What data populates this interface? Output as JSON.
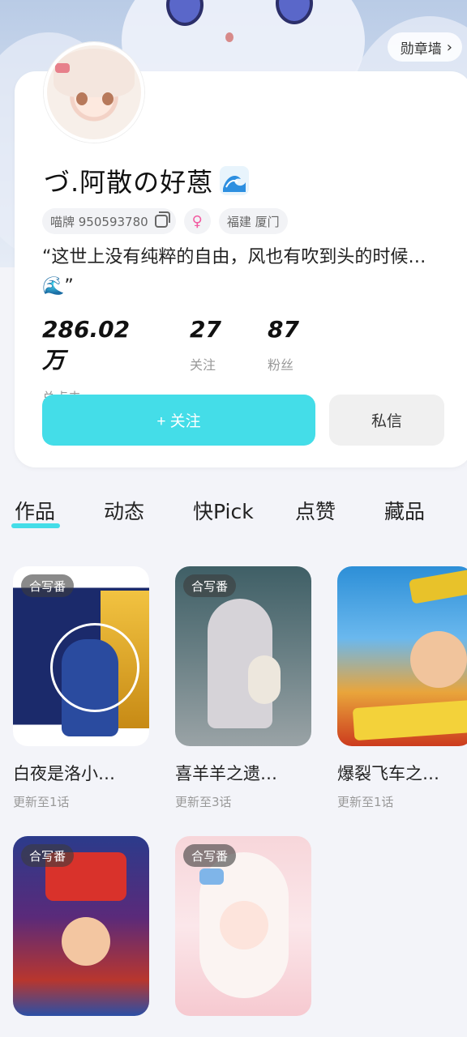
{
  "header": {
    "medal_wall_label": "勋章墙"
  },
  "profile": {
    "nickname": "づ.阿散の好蒽",
    "id_label": "喵牌 950593780",
    "gender_symbol": "♀",
    "location": "福建 厦门",
    "bio": "“这世上没有纯粹的自由，风也有吹到头的时候…🌊”",
    "stats": [
      {
        "value": "286.02万",
        "label": "总点击"
      },
      {
        "value": "27",
        "label": "关注"
      },
      {
        "value": "87",
        "label": "粉丝"
      }
    ],
    "follow_label": "+ 关注",
    "message_label": "私信",
    "accent_color": "#44dde8"
  },
  "tabs": [
    {
      "label": "作品",
      "active": true
    },
    {
      "label": "动态",
      "active": false
    },
    {
      "label": "快Pick",
      "active": false
    },
    {
      "label": "点赞",
      "active": false
    },
    {
      "label": "藏品",
      "active": false
    }
  ],
  "works": [
    {
      "badge": "合写番",
      "title": "白夜是洛小…",
      "subtitle": "更新至1话"
    },
    {
      "badge": "合写番",
      "title": "喜羊羊之遗…",
      "subtitle": "更新至3话"
    },
    {
      "badge": "",
      "title": "爆裂飞车之…",
      "subtitle": "更新至1话"
    },
    {
      "badge": "合写番",
      "title": "",
      "subtitle": ""
    },
    {
      "badge": "合写番",
      "title": "",
      "subtitle": ""
    }
  ]
}
